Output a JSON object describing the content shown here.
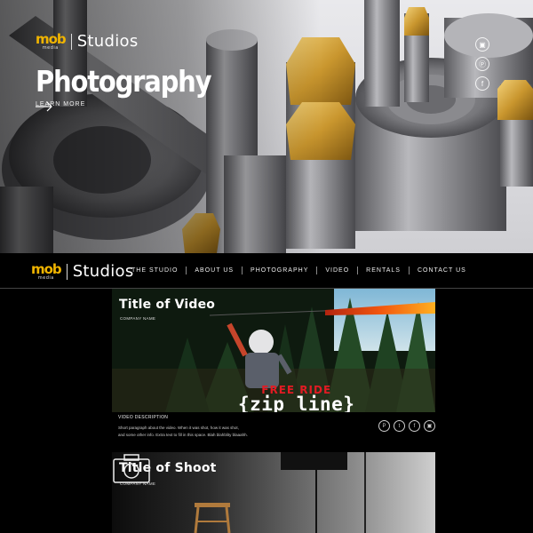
{
  "brand": {
    "logo_mark": "mob",
    "logo_sub": "media",
    "logo_text": "Studios",
    "accent": "#f0b400"
  },
  "hero": {
    "title": "Photography",
    "cta_label": "LEARN MORE",
    "social_icons": [
      "instagram-icon",
      "pinterest-icon",
      "facebook-icon"
    ]
  },
  "nav": {
    "links": [
      "THE STUDIO",
      "ABOUT US",
      "PHOTOGRAPHY",
      "VIDEO",
      "RENTALS",
      "CONTACT US"
    ]
  },
  "video_card": {
    "title": "Title of Video",
    "company": "COMPANY NAME",
    "promo_top": "FREE RIDE",
    "promo_main": "{zip line}",
    "description_label": "VIDEO DESCRIPTION",
    "description_lines": [
      "Short paragraph about the video. When it was shot, how it was shot,",
      "and some other info. Extra text to fill in this space. Blah blahblity blaaahh."
    ],
    "share_icons": [
      "pinterest-icon",
      "twitter-icon",
      "facebook-icon",
      "instagram-icon"
    ]
  },
  "shoot_card": {
    "title": "Title of Shoot",
    "company": "COMPANY NAME"
  }
}
